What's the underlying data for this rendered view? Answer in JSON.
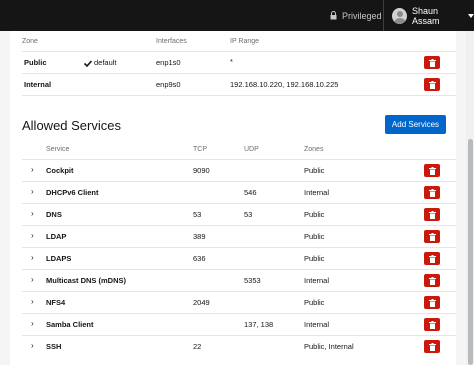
{
  "topbar": {
    "privileged_label": "Privileged",
    "user_name": "Shaun Assam"
  },
  "zones_table": {
    "headers": [
      "Zone",
      "Interfaces",
      "IP Range"
    ],
    "rows": [
      {
        "zone": "Public",
        "default_label": "default",
        "interfaces": "enp1s0",
        "ip_range": "*"
      },
      {
        "zone": "Internal",
        "default_label": "",
        "interfaces": "enp9s0",
        "ip_range": "192.168.10.220, 192.168.10.225"
      }
    ]
  },
  "services": {
    "title": "Allowed Services",
    "add_button": "Add Services",
    "headers": [
      "Service",
      "TCP",
      "UDP",
      "Zones"
    ],
    "rows": [
      {
        "service": "Cockpit",
        "tcp": "9090",
        "udp": "",
        "zones": "Public"
      },
      {
        "service": "DHCPv6 Client",
        "tcp": "",
        "udp": "546",
        "zones": "Internal"
      },
      {
        "service": "DNS",
        "tcp": "53",
        "udp": "53",
        "zones": "Public"
      },
      {
        "service": "LDAP",
        "tcp": "389",
        "udp": "",
        "zones": "Public"
      },
      {
        "service": "LDAPS",
        "tcp": "636",
        "udp": "",
        "zones": "Public"
      },
      {
        "service": "Multicast DNS (mDNS)",
        "tcp": "",
        "udp": "5353",
        "zones": "Internal"
      },
      {
        "service": "NFS4",
        "tcp": "2049",
        "udp": "",
        "zones": "Public"
      },
      {
        "service": "Samba Client",
        "tcp": "",
        "udp": "137, 138",
        "zones": "Internal"
      },
      {
        "service": "SSH",
        "tcp": "22",
        "udp": "",
        "zones": "Public, Internal"
      }
    ]
  },
  "colors": {
    "danger": "#c9190b",
    "primary": "#0066cc",
    "topbar": "#151515"
  }
}
